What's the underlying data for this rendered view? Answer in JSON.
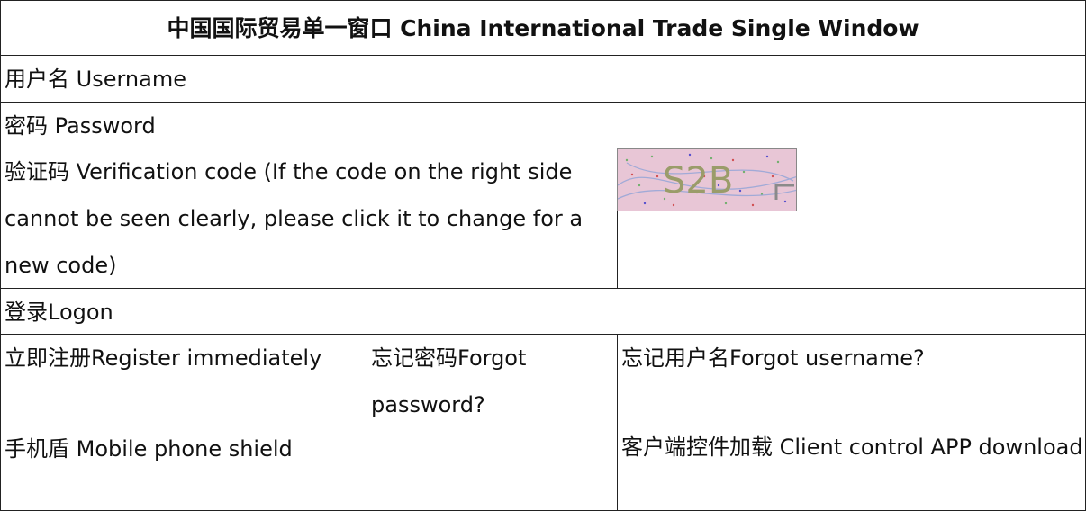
{
  "header": {
    "title": "中国国际贸易单一窗口 China International Trade Single Window"
  },
  "form": {
    "username_label": "用户名 Username",
    "password_label": "密码 Password",
    "verification_label": "验证码 Verification code (If the code on the right side cannot be seen clearly, please click it to change for a new code)",
    "captcha_text": "S2B",
    "logon_label": "登录Logon"
  },
  "links": {
    "register": "立即注册Register immediately",
    "forgot_password": "忘记密码Forgot password?",
    "forgot_username": "忘记用户名Forgot username?",
    "mobile_shield": "手机盾 Mobile phone shield",
    "client_download": "客户端控件加载 Client control APP download"
  },
  "colors": {
    "border": "#222222",
    "captcha_bg": "#e8c6d6",
    "captcha_glyph": "#9a9c6a"
  }
}
